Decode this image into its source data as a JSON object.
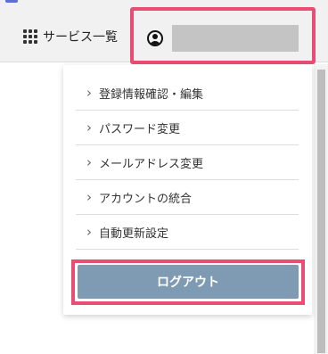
{
  "header": {
    "services_label": "サービス一覧",
    "services_icon": "grid-dots-icon",
    "account_icon": "user-circle-icon",
    "account_name_redacted": true
  },
  "account_menu": {
    "items": [
      {
        "label": "登録情報確認・編集",
        "icon": "chevron-right-icon"
      },
      {
        "label": "パスワード変更",
        "icon": "chevron-right-icon"
      },
      {
        "label": "メールアドレス変更",
        "icon": "chevron-right-icon"
      },
      {
        "label": "アカウントの統合",
        "icon": "chevron-right-icon"
      },
      {
        "label": "自動更新設定",
        "icon": "chevron-right-icon"
      }
    ],
    "logout_label": "ログアウト"
  },
  "colors": {
    "highlight": "#e84d73",
    "logout_button": "#7e9bb3",
    "topbar_background": "#f1f1f1",
    "top_accent": "#5b6fd6"
  }
}
